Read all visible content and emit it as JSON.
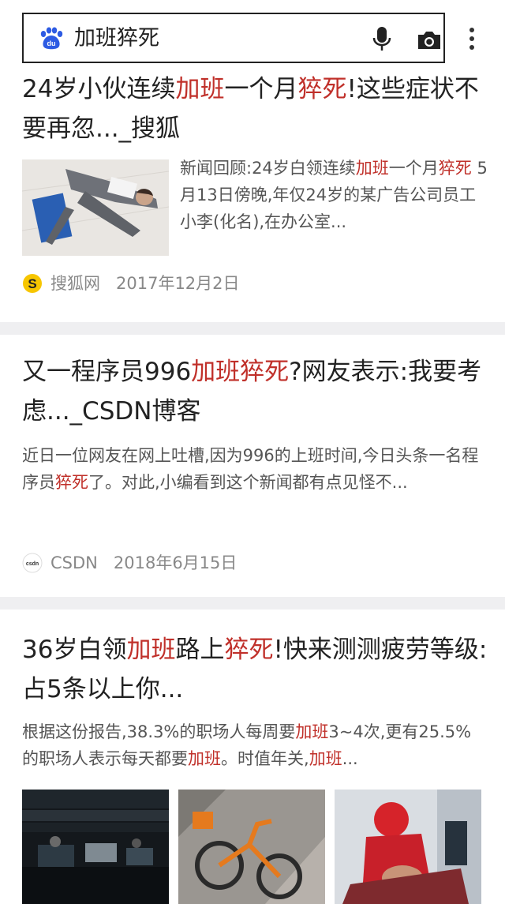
{
  "search": {
    "query": "加班猝死"
  },
  "results": [
    {
      "title": [
        {
          "t": "24岁小伙连续",
          "hl": false
        },
        {
          "t": "加班",
          "hl": true
        },
        {
          "t": "一个月",
          "hl": false
        },
        {
          "t": "猝死",
          "hl": true
        },
        {
          "t": "!这些症状不要再忽..._搜狐",
          "hl": false
        }
      ],
      "snippet": [
        {
          "t": "新闻回顾:24岁白领连续",
          "hl": false
        },
        {
          "t": "加班",
          "hl": true
        },
        {
          "t": "一个月",
          "hl": false
        },
        {
          "t": "猝死",
          "hl": true
        },
        {
          "t": " 5月13日傍晚,年仅24岁的某广告公司员工小李(化名),在办公室...",
          "hl": false
        }
      ],
      "source": "搜狐网",
      "date": "2017年12月2日"
    },
    {
      "title": [
        {
          "t": "又一程序员996",
          "hl": false
        },
        {
          "t": "加班猝死",
          "hl": true
        },
        {
          "t": "?网友表示:我要考虑..._CSDN博客",
          "hl": false
        }
      ],
      "snippet": [
        {
          "t": "近日一位网友在网上吐槽,因为996的上班时间,今日头条一名程序员",
          "hl": false
        },
        {
          "t": "猝死",
          "hl": true
        },
        {
          "t": "了。对此,小编看到这个新闻都有点见怪不...",
          "hl": false
        }
      ],
      "source": "CSDN",
      "date": "2018年6月15日"
    },
    {
      "title": [
        {
          "t": "36岁白领",
          "hl": false
        },
        {
          "t": "加班",
          "hl": true
        },
        {
          "t": "路上",
          "hl": false
        },
        {
          "t": "猝死",
          "hl": true
        },
        {
          "t": "!快来测测疲劳等级:占5条以上你...",
          "hl": false
        }
      ],
      "snippet": [
        {
          "t": "根据这份报告,38.3%的职场人每周要",
          "hl": false
        },
        {
          "t": "加班",
          "hl": true
        },
        {
          "t": "3~4次,更有25.5%的职场人表示每天都要",
          "hl": false
        },
        {
          "t": "加班",
          "hl": true
        },
        {
          "t": "。时值年关,",
          "hl": false
        },
        {
          "t": "加班",
          "hl": true
        },
        {
          "t": "...",
          "hl": false
        }
      ]
    }
  ],
  "colors": {
    "highlight": "#c0302a",
    "text": "#222222",
    "muted": "#888888",
    "page_bg": "#efeff1"
  },
  "icons": [
    "baidu-paw-icon",
    "microphone-icon",
    "camera-icon",
    "more-vertical-icon",
    "sohu-icon",
    "csdn-icon"
  ]
}
